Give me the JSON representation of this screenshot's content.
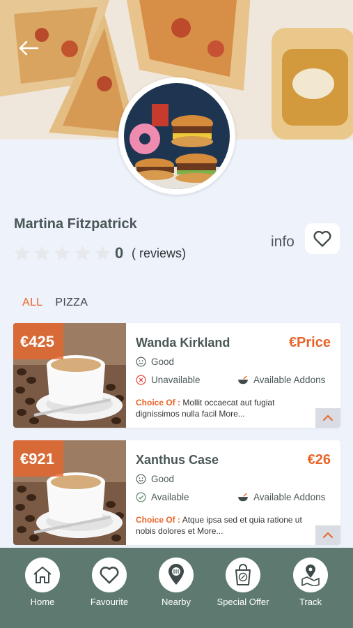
{
  "restaurant": {
    "name": "Martina Fitzpatrick",
    "rating_value": 0,
    "rating_count": "0",
    "reviews_label": "( reviews)",
    "info_label": "info"
  },
  "tabs": [
    {
      "label": "ALL",
      "active": true
    },
    {
      "label": "PIZZA",
      "active": false
    }
  ],
  "items": [
    {
      "badge_price": "€425",
      "title": "Wanda Kirkland",
      "price": "€Price",
      "rating_text": "Good",
      "availability": "Unavailable",
      "addons_label": "Available Addons",
      "choice_label": "Choice Of :",
      "choice_text": "Mollit occaecat aut fugiat dignissimos nulla facil",
      "more_label": "More..."
    },
    {
      "badge_price": "€921",
      "title": "Xanthus Case",
      "price": "€26",
      "rating_text": "Good",
      "availability": "Available",
      "addons_label": "Available Addons",
      "choice_label": "Choice Of :",
      "choice_text": "Atque ipsa sed et quia ratione ut nobis dolores et",
      "more_label": "More..."
    }
  ],
  "bottom_nav": [
    {
      "label": "Home",
      "icon": "home-icon"
    },
    {
      "label": "Favourite",
      "icon": "heart-icon"
    },
    {
      "label": "Nearby",
      "icon": "location-pin-icon"
    },
    {
      "label": "Special Offer",
      "icon": "shopping-bag-icon"
    },
    {
      "label": "Track",
      "icon": "map-pin-icon"
    }
  ],
  "colors": {
    "accent": "#e8652a",
    "nav_background": "#5e7a70",
    "page_background": "#eef2fa",
    "unavailable": "#e0443a",
    "available": "#5c8a70"
  }
}
